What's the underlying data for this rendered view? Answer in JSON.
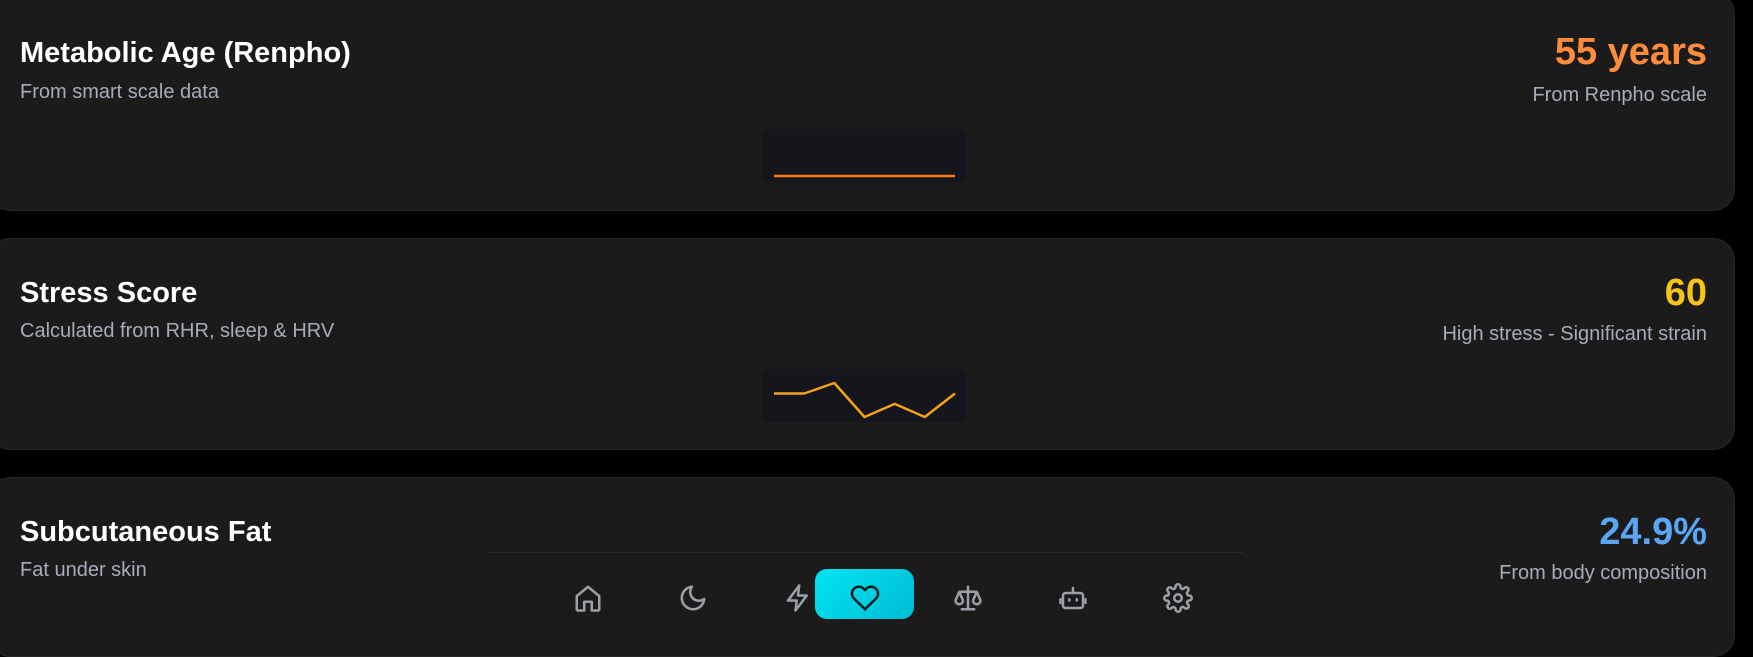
{
  "cards": [
    {
      "title": "Metabolic Age (Renpho)",
      "subtitle": "From smart scale data",
      "value": "55 years",
      "value_color": "#ff8c3a",
      "note": "From Renpho scale",
      "sparkline": {
        "color": "#ff7a1a",
        "values": [
          55,
          55,
          55,
          55,
          55,
          55,
          55
        ]
      }
    },
    {
      "title": "Stress Score",
      "subtitle": "Calculated from RHR, sleep & HRV",
      "value": "60",
      "value_color": "#f6c419",
      "note": "High stress - Significant strain",
      "sparkline": {
        "color": "#f5a21a",
        "values": [
          62,
          62,
          66,
          53,
          58,
          53,
          62
        ]
      }
    },
    {
      "title": "Subcutaneous Fat",
      "subtitle": "Fat under skin",
      "value": "24.9%",
      "value_color": "#5aa6f5",
      "note": "From body composition"
    }
  ],
  "nav": {
    "items": [
      {
        "icon": "home-icon"
      },
      {
        "icon": "moon-icon"
      },
      {
        "icon": "lightning-icon"
      },
      {
        "icon": "heart-icon",
        "active": true
      },
      {
        "icon": "scale-icon"
      },
      {
        "icon": "robot-icon"
      },
      {
        "icon": "gear-icon"
      }
    ],
    "active_color": "#00d8e6"
  }
}
